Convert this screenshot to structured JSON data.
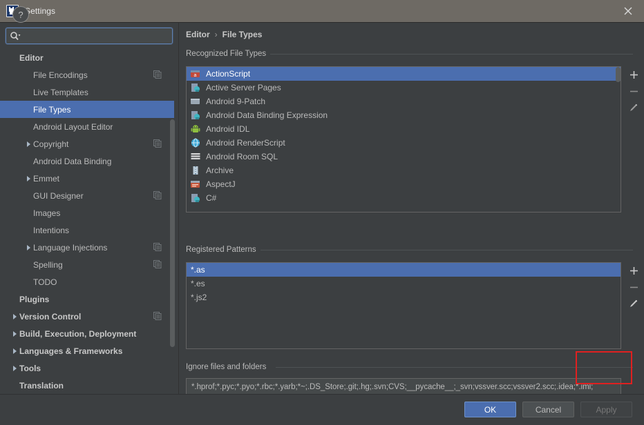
{
  "window": {
    "title": "Settings",
    "app_icon": "intellij-idea-icon",
    "close_label": "✕"
  },
  "search": {
    "value": "",
    "placeholder": "",
    "icon": "search-icon"
  },
  "sidebar": {
    "items": [
      {
        "label": "Editor",
        "indent": 0,
        "bold": true,
        "arrow": false,
        "copy": false,
        "selected": false
      },
      {
        "label": "File Encodings",
        "indent": 1,
        "bold": false,
        "arrow": false,
        "copy": true,
        "selected": false
      },
      {
        "label": "Live Templates",
        "indent": 1,
        "bold": false,
        "arrow": false,
        "copy": false,
        "selected": false
      },
      {
        "label": "File Types",
        "indent": 1,
        "bold": false,
        "arrow": false,
        "copy": false,
        "selected": true
      },
      {
        "label": "Android Layout Editor",
        "indent": 1,
        "bold": false,
        "arrow": false,
        "copy": false,
        "selected": false
      },
      {
        "label": "Copyright",
        "indent": 1,
        "bold": false,
        "arrow": true,
        "copy": true,
        "selected": false
      },
      {
        "label": "Android Data Binding",
        "indent": 1,
        "bold": false,
        "arrow": false,
        "copy": false,
        "selected": false
      },
      {
        "label": "Emmet",
        "indent": 1,
        "bold": false,
        "arrow": true,
        "copy": false,
        "selected": false
      },
      {
        "label": "GUI Designer",
        "indent": 1,
        "bold": false,
        "arrow": false,
        "copy": true,
        "selected": false
      },
      {
        "label": "Images",
        "indent": 1,
        "bold": false,
        "arrow": false,
        "copy": false,
        "selected": false
      },
      {
        "label": "Intentions",
        "indent": 1,
        "bold": false,
        "arrow": false,
        "copy": false,
        "selected": false
      },
      {
        "label": "Language Injections",
        "indent": 1,
        "bold": false,
        "arrow": true,
        "copy": true,
        "selected": false
      },
      {
        "label": "Spelling",
        "indent": 1,
        "bold": false,
        "arrow": false,
        "copy": true,
        "selected": false
      },
      {
        "label": "TODO",
        "indent": 1,
        "bold": false,
        "arrow": false,
        "copy": false,
        "selected": false
      },
      {
        "label": "Plugins",
        "indent": 0,
        "bold": true,
        "arrow": false,
        "copy": false,
        "selected": false
      },
      {
        "label": "Version Control",
        "indent": 0,
        "bold": true,
        "arrow": true,
        "copy": true,
        "selected": false
      },
      {
        "label": "Build, Execution, Deployment",
        "indent": 0,
        "bold": true,
        "arrow": true,
        "copy": false,
        "selected": false
      },
      {
        "label": "Languages & Frameworks",
        "indent": 0,
        "bold": true,
        "arrow": true,
        "copy": false,
        "selected": false
      },
      {
        "label": "Tools",
        "indent": 0,
        "bold": true,
        "arrow": true,
        "copy": false,
        "selected": false
      },
      {
        "label": "Translation",
        "indent": 0,
        "bold": true,
        "arrow": false,
        "copy": false,
        "selected": false
      }
    ]
  },
  "breadcrumb": {
    "root": "Editor",
    "separator": "›",
    "current": "File Types"
  },
  "recognized_file_types": {
    "group_label": "Recognized File Types",
    "items": [
      {
        "label": "ActionScript",
        "icon": "actionscript-file-icon",
        "selected": true
      },
      {
        "label": "Active Server Pages",
        "icon": "asp-file-icon",
        "selected": false
      },
      {
        "label": "Android 9-Patch",
        "icon": "image-file-icon",
        "selected": false
      },
      {
        "label": "Android Data Binding Expression",
        "icon": "asp-file-icon",
        "selected": false
      },
      {
        "label": "Android IDL",
        "icon": "android-robot-icon",
        "selected": false
      },
      {
        "label": "Android RenderScript",
        "icon": "renderscript-globe-icon",
        "selected": false
      },
      {
        "label": "Android Room SQL",
        "icon": "sql-table-icon",
        "selected": false
      },
      {
        "label": "Archive",
        "icon": "archive-file-icon",
        "selected": false
      },
      {
        "label": "AspectJ",
        "icon": "aspectj-file-icon",
        "selected": false
      },
      {
        "label": "C#",
        "icon": "csharp-file-icon",
        "selected": false
      }
    ],
    "toolbar": [
      {
        "name": "add-file-type-button",
        "glyph": "+"
      },
      {
        "name": "remove-file-type-button",
        "glyph": "−"
      },
      {
        "name": "edit-file-type-button",
        "glyph": "pencil"
      }
    ]
  },
  "registered_patterns": {
    "group_label": "Registered Patterns",
    "items": [
      {
        "label": "*.as",
        "selected": true
      },
      {
        "label": "*.es",
        "selected": false
      },
      {
        "label": "*.js2",
        "selected": false
      }
    ],
    "toolbar": [
      {
        "name": "add-pattern-button",
        "glyph": "+"
      },
      {
        "name": "remove-pattern-button",
        "glyph": "−"
      },
      {
        "name": "edit-pattern-button",
        "glyph": "pencil"
      }
    ]
  },
  "ignore": {
    "group_label": "Ignore files and folders",
    "value": "*.hprof;*.pyc;*.pyo;*.rbc;*.yarb;*~;.DS_Store;.git;.hg;.svn;CVS;__pycache__;_svn;vssver.scc;vssver2.scc;.idea;*.iml;",
    "placeholder": ""
  },
  "annotation": {
    "color": "#e02020",
    "shape": "rectangle-highlight"
  },
  "footer": {
    "help_label": "?",
    "ok_label": "OK",
    "cancel_label": "Cancel",
    "apply_label": "Apply"
  },
  "colors": {
    "background": "#3c3f41",
    "titlebar": "#6e6a64",
    "selection": "#4b6eaf",
    "text": "#bbbbbb",
    "accent_red": "#e02020"
  }
}
